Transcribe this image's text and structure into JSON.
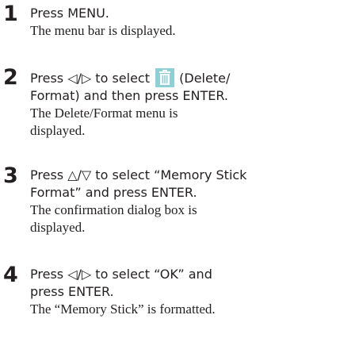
{
  "steps": [
    {
      "number": "1",
      "instruction_lines": [
        "Press MENU."
      ],
      "result_lines": [
        "The menu bar is displayed."
      ]
    },
    {
      "number": "2",
      "instruction_line1_prefix": "Press ",
      "instruction_line1_arrows": "◁/▷",
      "instruction_line1_middle": " to select ",
      "icon": "trash-delete-icon",
      "instruction_line1_suffix": " (Delete/",
      "instruction_line2": "Format) and then press ENTER.",
      "result_lines": [
        "The Delete/Format menu is",
        "displayed."
      ]
    },
    {
      "number": "3",
      "instruction_line1_prefix": "Press ",
      "instruction_line1_arrows": "△/▽",
      "instruction_line1_suffix": " to select “Memory Stick",
      "instruction_line2": "Format” and press ENTER.",
      "result_lines": [
        "The confirmation dialog box is",
        "displayed."
      ]
    },
    {
      "number": "4",
      "instruction_line1_prefix": "Press ",
      "instruction_line1_arrows": "◁/▷",
      "instruction_line1_suffix": " to select “OK” and",
      "instruction_line2": "press ENTER.",
      "result_lines": [
        "The “Memory Stick” is formatted."
      ]
    }
  ],
  "colors": {
    "text": "#231f20",
    "icon_bg": "#8fcfd6",
    "icon_fg": "#ffffff"
  }
}
